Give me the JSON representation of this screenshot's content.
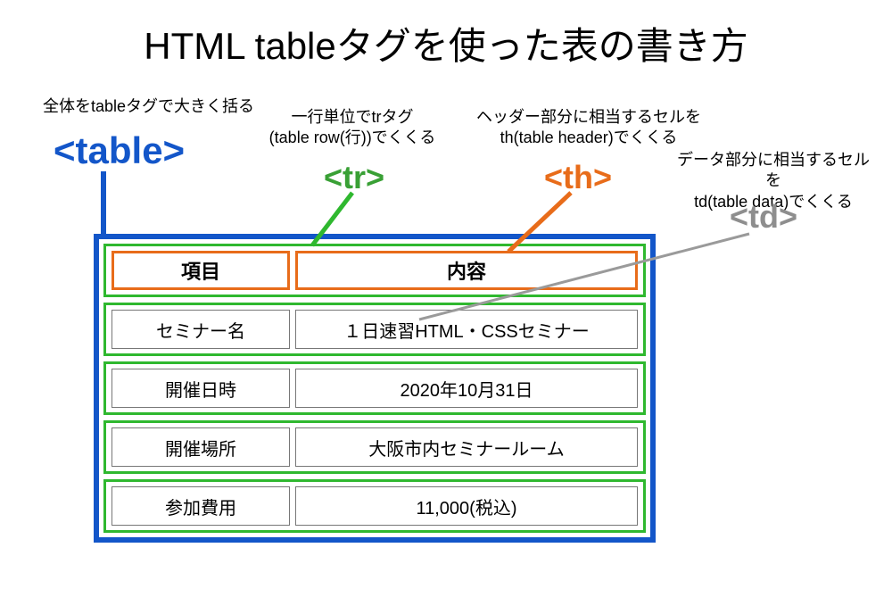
{
  "title": "HTML tableタグを使った表の書き方",
  "annotations": {
    "table_desc": "全体をtableタグで大きく括る",
    "tr_desc_line1": "一行単位でtrタグ",
    "tr_desc_line2": "(table row(行))でくくる",
    "th_desc_line1": "ヘッダー部分に相当するセルを",
    "th_desc_line2": "th(table header)でくくる",
    "td_desc_line1": "データ部分に相当するセルを",
    "td_desc_line2": "td(table data)でくくる"
  },
  "tags": {
    "table": "<table>",
    "tr": "<tr>",
    "th": "<th>",
    "td": "<td>"
  },
  "table": {
    "headers": {
      "col1": "項目",
      "col2": "内容"
    },
    "rows": [
      {
        "label": "セミナー名",
        "value": "１日速習HTML・CSSセミナー"
      },
      {
        "label": "開催日時",
        "value": "2020年10月31日"
      },
      {
        "label": "開催場所",
        "value": "大阪市内セミナールーム"
      },
      {
        "label": "参加費用",
        "value": "11,000(税込)"
      }
    ]
  },
  "colors": {
    "table_border": "#1356c9",
    "tr_border": "#2fb82f",
    "th_border": "#e86c1a",
    "td_border": "#777777"
  }
}
